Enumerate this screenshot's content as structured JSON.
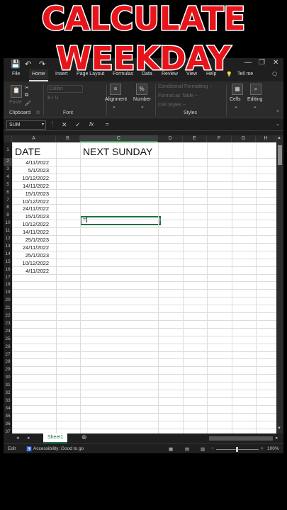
{
  "overlay": {
    "line1": "CALCULATE",
    "line2": "WEEKDAY",
    "color": "#e8141b"
  },
  "qat": {
    "save_icon": "💾",
    "undo_icon": "↶",
    "redo_icon": "↷"
  },
  "menu": [
    "File",
    "Home",
    "Insert",
    "Page Layout",
    "Formulas",
    "Data",
    "Review",
    "View",
    "Help",
    "Tell me"
  ],
  "ribbon": {
    "clipboard": {
      "paste": "Paste",
      "label": "Clipboard"
    },
    "font": {
      "name_box": "Calibri",
      "label": "Font"
    },
    "alignment": "Alignment",
    "number": {
      "icon": "%",
      "label": "Number"
    },
    "styles": {
      "cond": "Conditional Formatting ~",
      "table": "Format as Table ~",
      "cell": "Cell Styles ~",
      "label": "Styles"
    },
    "cells": "Cells",
    "editing": "Editing"
  },
  "formula_bar": {
    "name_box": "SUM",
    "fx": "fx",
    "cancel": "✕",
    "enter": "✓",
    "value": "="
  },
  "columns": [
    "A",
    "B",
    "C",
    "D",
    "E",
    "F",
    "G",
    "H"
  ],
  "rows": [
    "1",
    "2",
    "3",
    "4",
    "5",
    "6",
    "7",
    "8",
    "9",
    "10",
    "11",
    "12",
    "13",
    "14",
    "15",
    "16",
    "17",
    "18",
    "19",
    "20",
    "21",
    "22",
    "23",
    "24",
    "25",
    "26",
    "27",
    "28",
    "29",
    "30",
    "31",
    "32",
    "33",
    "34",
    "35",
    "36",
    "37"
  ],
  "sheet": {
    "header_a": "DATE",
    "header_c": "NEXT SUNDAY",
    "dates": [
      "4/11/2022",
      "5/1/2023",
      "10/12/2022",
      "14/11/2022",
      "15/1/2023",
      "10/12/2022",
      "24/11/2022",
      "15/1/2023",
      "10/12/2022",
      "14/11/2022",
      "25/1/2023",
      "24/11/2022",
      "25/1/2023",
      "10/12/2022",
      "4/11/2022"
    ],
    "active_cell_value": "="
  },
  "sheet_tab": "Sheet1",
  "status": {
    "mode": "Edit",
    "accessibility": "Accessibility: Good to go",
    "zoom": "100%"
  }
}
